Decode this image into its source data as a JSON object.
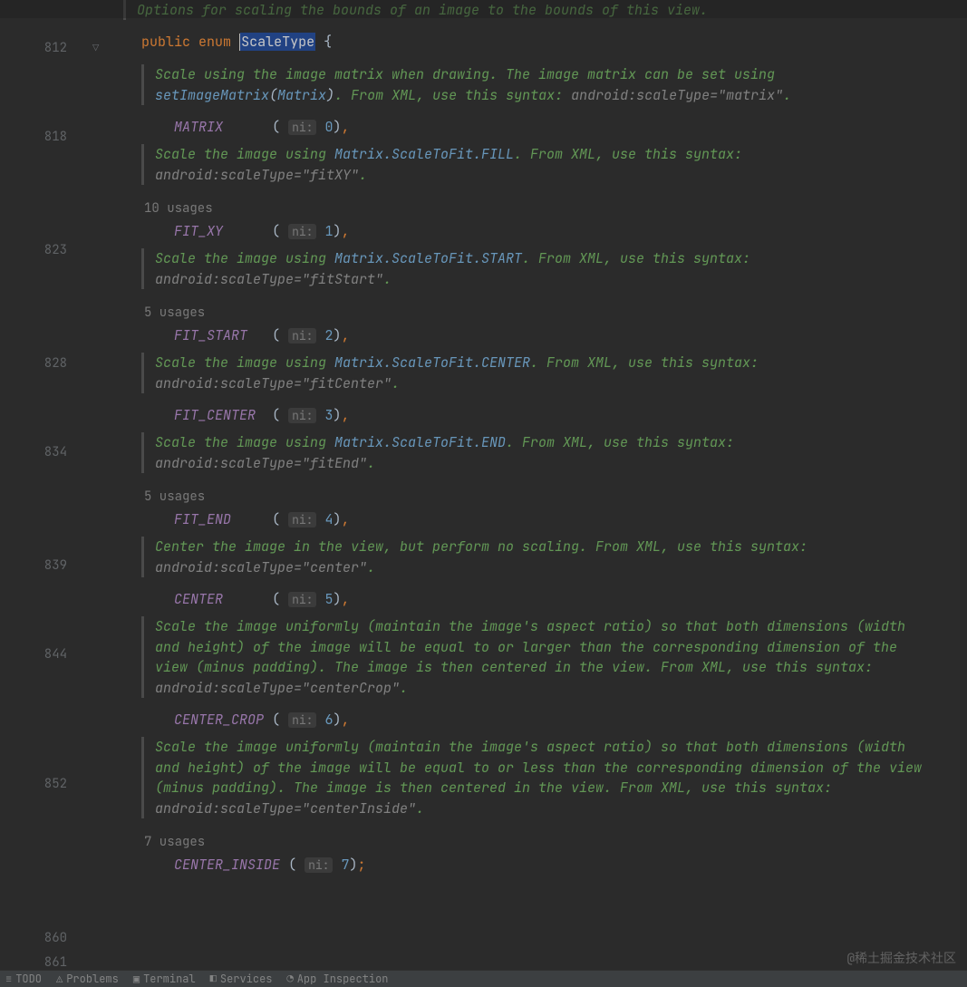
{
  "gutter": {
    "l812": "812",
    "l818": "818",
    "l823": "823",
    "l828": "828",
    "l834": "834",
    "l839": "839",
    "l844": "844",
    "l852": "852",
    "l860": "860",
    "l861": "861"
  },
  "code": {
    "top_doc": "Options for scaling the bounds of an image to the bounds of this view.",
    "kw_public": "public",
    "kw_enum": "enum",
    "type_name": "ScaleType",
    "brace_open": "{",
    "hint_ni": "ni:",
    "paren_open": "(",
    "paren_close": ")",
    "comma": ",",
    "semicolon": ";",
    "entries": {
      "matrix": {
        "name": "MATRIX",
        "value": "0",
        "doc_a": "Scale using the image matrix when drawing. The image matrix can be set using ",
        "doc_link1": "setImageMatrix",
        "doc_paren_o": "(",
        "doc_link2": "Matrix",
        "doc_paren_c": ")",
        "doc_b": ". From XML, use this syntax: ",
        "doc_code": "android:scaleType=\"matrix\"",
        "doc_end": "."
      },
      "fitxy": {
        "name": "FIT_XY",
        "value": "1",
        "usages": "10 usages",
        "doc_a": "Scale the image using ",
        "doc_link": "Matrix.ScaleToFit.FILL",
        "doc_b": ". From XML, use this syntax: ",
        "doc_code": "android:scaleType=\"fitXY\"",
        "doc_end": "."
      },
      "fitstart": {
        "name": "FIT_START",
        "value": "2",
        "usages": "5 usages",
        "doc_a": "Scale the image using ",
        "doc_link": "Matrix.ScaleToFit.START",
        "doc_b": ". From XML, use this syntax: ",
        "doc_code": "android:scaleType=\"fitStart\"",
        "doc_end": "."
      },
      "fitcenter": {
        "name": "FIT_CENTER",
        "value": "3",
        "doc_a": "Scale the image using ",
        "doc_link": "Matrix.ScaleToFit.CENTER",
        "doc_b": ". From XML, use this syntax: ",
        "doc_code": "android:scaleType=\"fitCenter\"",
        "doc_end": "."
      },
      "fitend": {
        "name": "FIT_END",
        "value": "4",
        "usages": "5 usages",
        "doc_a": "Scale the image using ",
        "doc_link": "Matrix.ScaleToFit.END",
        "doc_b": ". From XML, use this syntax: ",
        "doc_code": "android:scaleType=\"fitEnd\"",
        "doc_end": "."
      },
      "center": {
        "name": "CENTER",
        "value": "5",
        "doc_a": "Center the image in the view, but perform no scaling. From XML, use this syntax: ",
        "doc_code": "android:scaleType=\"center\"",
        "doc_end": "."
      },
      "centercrop": {
        "name": "CENTER_CROP",
        "value": "6",
        "doc_a": "Scale the image uniformly (maintain the image's aspect ratio) so that both dimensions (width and height) of the image will be equal to or larger than the corresponding dimension of the view (minus padding). The image is then centered in the view. From XML, use this syntax: ",
        "doc_code": "android:scaleType=\"centerCrop\"",
        "doc_end": "."
      },
      "centerinside": {
        "name": "CENTER_INSIDE",
        "value": "7",
        "usages": "7 usages",
        "doc_a": "Scale the image uniformly (maintain the image's aspect ratio) so that both dimensions (width and height) of the image will be equal to or less than the corresponding dimension of the view (minus padding). The image is then centered in the view. From XML, use this syntax: ",
        "doc_code": "android:scaleType=\"centerInside\"",
        "doc_end": "."
      }
    }
  },
  "bottombar": {
    "i1": "",
    "i2": "TODO",
    "i3": "Problems",
    "i4": "Terminal",
    "i5": "Services",
    "i6": "App Inspection"
  },
  "watermark": "@稀土掘金技术社区"
}
